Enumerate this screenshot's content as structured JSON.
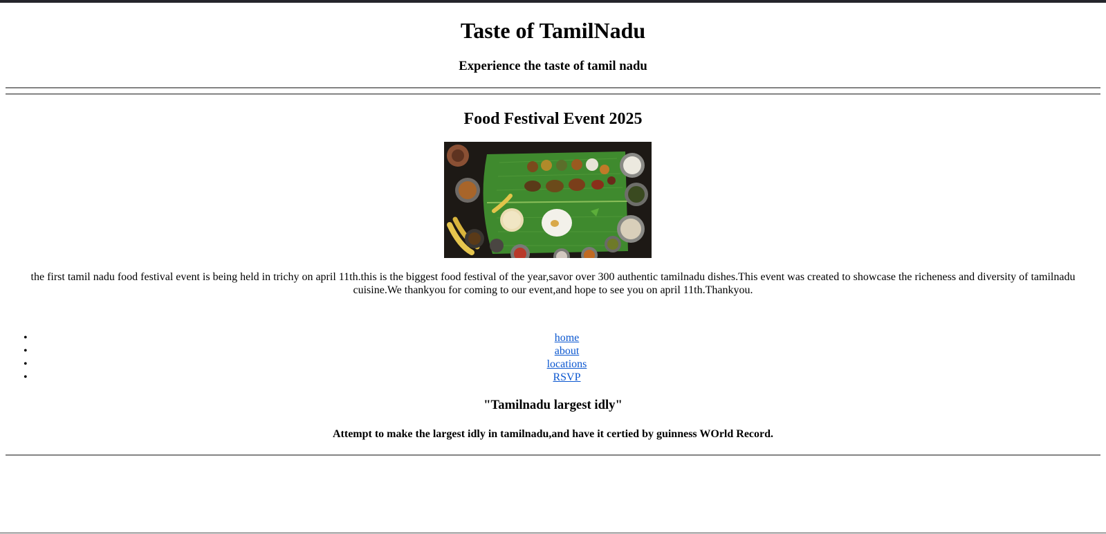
{
  "header": {
    "title": "Taste of TamilNadu",
    "tagline": "Experience the taste of tamil nadu"
  },
  "event": {
    "title": "Food Festival Event 2025",
    "image_description": "banana leaf meal",
    "intro": "the first tamil nadu food festival event is being held in trichy on april 11th.this is the biggest food festival of the year,savor over 300 authentic tamilnadu dishes.This event was created to showcase the richeness and diversity of tamilnadu cuisine.We thankyou for coming to our event,and hope to see you on april 11th.Thankyou."
  },
  "nav": {
    "items": [
      {
        "label": "home"
      },
      {
        "label": "about"
      },
      {
        "label": "locations"
      },
      {
        "label": "RSVP"
      }
    ]
  },
  "feature": {
    "title": "\"Tamilnadu largest idly\"",
    "description": "Attempt to make the largest idly in tamilnadu,and have it certied by guinness WOrld Record."
  },
  "colors": {
    "link": "#0b57d0",
    "top_bar": "#25252b",
    "leaf_green": "#3f8a2e"
  }
}
